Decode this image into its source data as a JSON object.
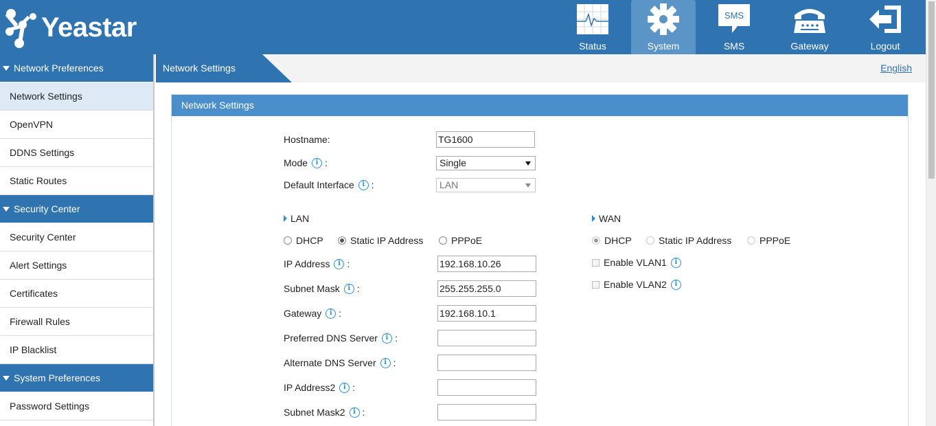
{
  "brand": {
    "name": "Yeastar"
  },
  "nav": [
    {
      "label": "Status",
      "icon": "status-monitor-icon",
      "active": false
    },
    {
      "label": "System",
      "icon": "gear-icon",
      "active": true
    },
    {
      "label": "SMS",
      "icon": "sms-bubble-icon",
      "icon_text": "SMS",
      "active": false
    },
    {
      "label": "Gateway",
      "icon": "telephone-icon",
      "active": false
    },
    {
      "label": "Logout",
      "icon": "logout-icon",
      "active": false
    }
  ],
  "sidebar": {
    "groups": [
      {
        "label": "Network Preferences",
        "items": [
          "Network Settings",
          "OpenVPN",
          "DDNS Settings",
          "Static Routes"
        ]
      },
      {
        "label": "Security Center",
        "items": [
          "Security Center",
          "Alert Settings",
          "Certificates",
          "Firewall Rules",
          "IP Blacklist"
        ]
      },
      {
        "label": "System Preferences",
        "items": [
          "Password Settings"
        ]
      }
    ],
    "active_item": "Network Settings"
  },
  "page": {
    "title": "Network Settings",
    "language": "English"
  },
  "panel": {
    "title": "Network Settings",
    "hostname": {
      "label": "Hostname:",
      "value": "TG1600"
    },
    "mode": {
      "label": "Mode",
      "value": "Single"
    },
    "default_interface": {
      "label": "Default Interface",
      "value": "LAN"
    },
    "lan": {
      "title": "LAN",
      "options": [
        "DHCP",
        "Static IP Address",
        "PPPoE"
      ],
      "selected": "Static IP Address",
      "fields": [
        {
          "label": "IP Address",
          "value": "192.168.10.26"
        },
        {
          "label": "Subnet Mask",
          "value": "255.255.255.0"
        },
        {
          "label": "Gateway",
          "value": "192.168.10.1"
        },
        {
          "label": "Preferred DNS Server",
          "value": ""
        },
        {
          "label": "Alternate DNS Server",
          "value": ""
        },
        {
          "label": "IP Address2",
          "value": ""
        },
        {
          "label": "Subnet Mask2",
          "value": ""
        }
      ]
    },
    "wan": {
      "title": "WAN",
      "options": [
        "DHCP",
        "Static IP Address",
        "PPPoE"
      ],
      "selected": "DHCP",
      "vlan1": "Enable VLAN1",
      "vlan2": "Enable VLAN2"
    }
  },
  "colors": {
    "primary": "#2f73b0",
    "panel_header": "#4a8ecb",
    "info": "#2d8fd5"
  }
}
